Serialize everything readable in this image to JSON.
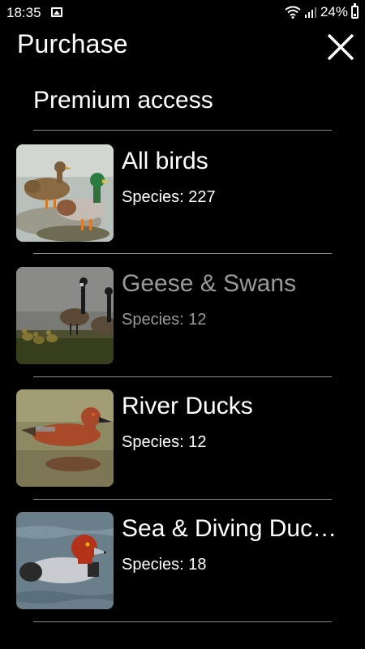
{
  "status_bar": {
    "time": "18:35",
    "battery": "24%"
  },
  "header": {
    "title": "Purchase",
    "close_icon": "close-icon"
  },
  "section": {
    "title": "Premium access"
  },
  "items": [
    {
      "name": "All birds",
      "species": "Species: 227",
      "image": "mallard-pair-photo",
      "dimmed": false
    },
    {
      "name": "Geese & Swans",
      "species": "Species: 12",
      "image": "geese-with-goslings-photo",
      "dimmed": true
    },
    {
      "name": "River Ducks",
      "species": "Species: 12",
      "image": "cinnamon-teal-photo",
      "dimmed": false
    },
    {
      "name": "Sea & Diving Duc…",
      "species": "Species: 18",
      "image": "redhead-duck-photo",
      "dimmed": false
    }
  ],
  "colors": {
    "background": "#000000",
    "text": "#ffffff",
    "dimmed_text": "#9a9a9a",
    "divider": "#8a8a8a"
  }
}
